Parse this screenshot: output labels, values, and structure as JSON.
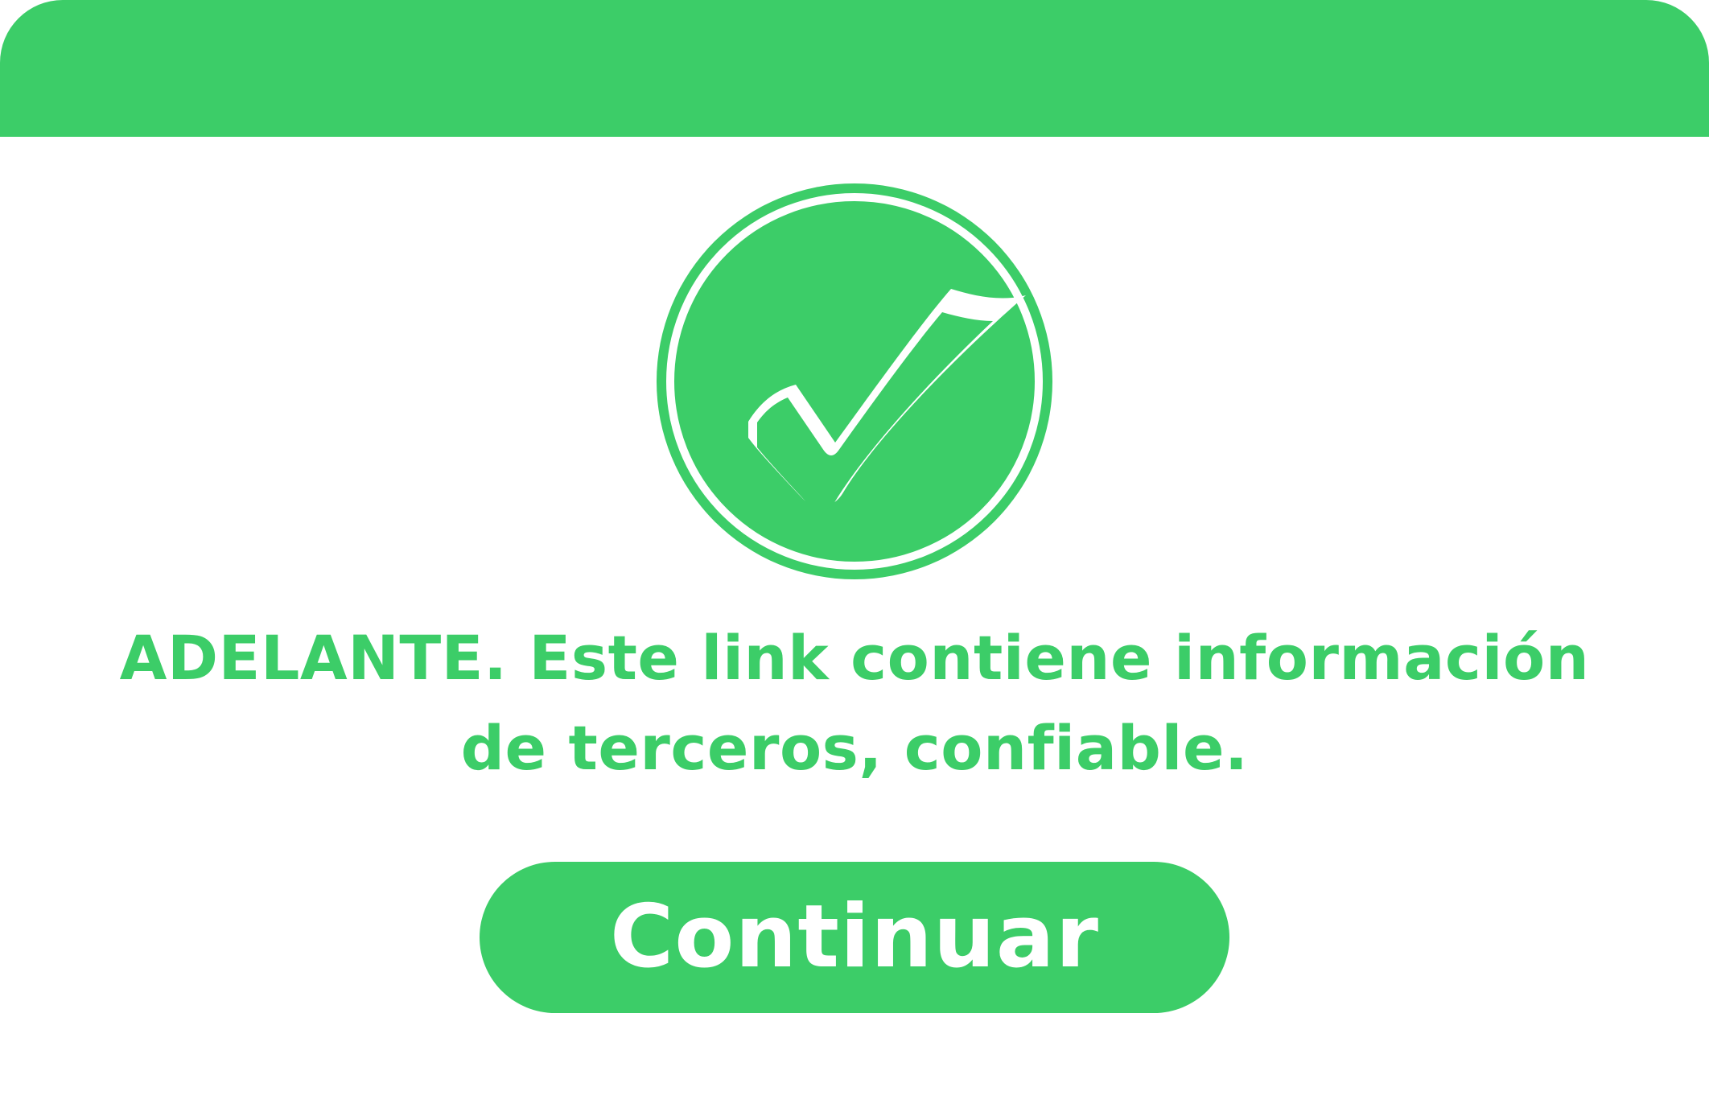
{
  "header": {
    "color": "#3ccd68"
  },
  "badge": {
    "icon": "check-circle-icon",
    "color": "#3ccd68"
  },
  "message": {
    "line1": "ADELANTE. Este link contiene información",
    "line2": "de terceros, confiable."
  },
  "actions": {
    "continue_label": "Continuar"
  }
}
